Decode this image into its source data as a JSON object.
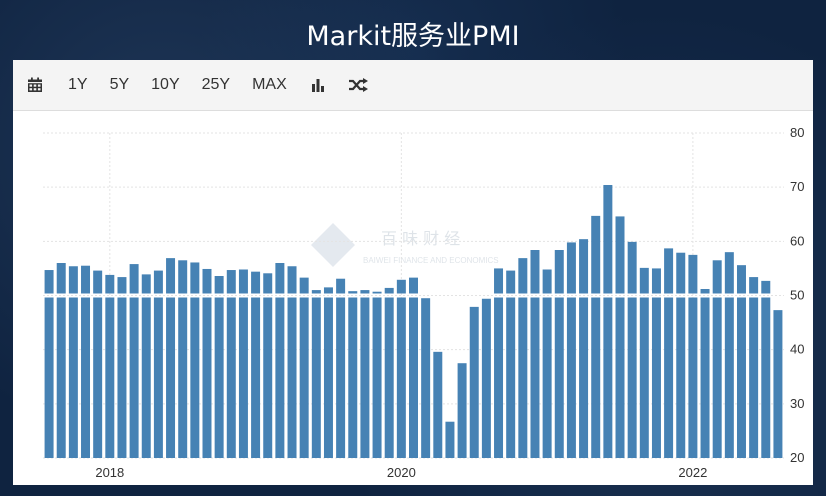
{
  "page_title": "Markit服务业PMI",
  "toolbar": {
    "calendar_icon": "calendar-icon",
    "buttons": [
      "1Y",
      "5Y",
      "10Y",
      "25Y",
      "MAX"
    ],
    "bar_chart_icon": "bar-chart-icon",
    "shuffle_icon": "shuffle-icon"
  },
  "watermark": {
    "cn": "百 味 财 经",
    "en": "BAIWEI FINANCE AND ECONOMICS"
  },
  "colors": {
    "bar": "#4682b4",
    "background": "#0f2340"
  },
  "chart_data": {
    "type": "bar",
    "baseline": 50,
    "ylim": [
      20,
      80
    ],
    "yticks": [
      20,
      30,
      40,
      50,
      60,
      70,
      80
    ],
    "xtick_labels": [
      {
        "label": "2018",
        "month": "2018-01"
      },
      {
        "label": "2020",
        "month": "2020-01"
      },
      {
        "label": "2022",
        "month": "2022-01"
      }
    ],
    "grid": true,
    "months": [
      "2017-08",
      "2017-09",
      "2017-10",
      "2017-11",
      "2017-12",
      "2018-01",
      "2018-02",
      "2018-03",
      "2018-04",
      "2018-05",
      "2018-06",
      "2018-07",
      "2018-08",
      "2018-09",
      "2018-10",
      "2018-11",
      "2018-12",
      "2019-01",
      "2019-02",
      "2019-03",
      "2019-04",
      "2019-05",
      "2019-06",
      "2019-07",
      "2019-08",
      "2019-09",
      "2019-10",
      "2019-11",
      "2019-12",
      "2020-01",
      "2020-02",
      "2020-03",
      "2020-04",
      "2020-05",
      "2020-06",
      "2020-07",
      "2020-08",
      "2020-09",
      "2020-10",
      "2020-11",
      "2020-12",
      "2021-01",
      "2021-02",
      "2021-03",
      "2021-04",
      "2021-05",
      "2021-06",
      "2021-07",
      "2021-08",
      "2021-09",
      "2021-10",
      "2021-11",
      "2021-12",
      "2022-01",
      "2022-02",
      "2022-03",
      "2022-04",
      "2022-05",
      "2022-06",
      "2022-07"
    ],
    "values": [
      54.7,
      56.0,
      55.4,
      55.5,
      54.6,
      53.8,
      53.4,
      55.8,
      53.9,
      54.6,
      56.9,
      56.5,
      56.1,
      54.9,
      53.6,
      54.7,
      54.8,
      54.4,
      54.1,
      56.0,
      55.4,
      53.3,
      51.0,
      51.5,
      53.1,
      50.8,
      51.0,
      50.7,
      51.4,
      52.9,
      53.3,
      49.5,
      39.6,
      26.7,
      37.5,
      47.9,
      49.4,
      55.0,
      54.6,
      56.9,
      58.4,
      54.8,
      58.4,
      59.8,
      60.4,
      64.7,
      70.4,
      64.6,
      59.9,
      55.1,
      55.0,
      58.7,
      57.9,
      57.5,
      51.2,
      56.5,
      58.0,
      55.6,
      53.4,
      52.7,
      47.3
    ]
  }
}
